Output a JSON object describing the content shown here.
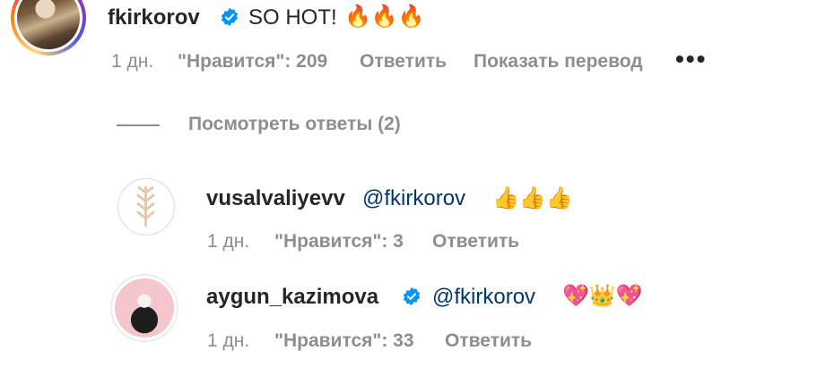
{
  "colors": {
    "text": "#262626",
    "muted": "#8e8e8e",
    "link": "#00376b",
    "verified": "#0095f6"
  },
  "main_comment": {
    "username": "fkirkorov",
    "verified": true,
    "text": "SO HOT!",
    "emoji": "🔥🔥🔥",
    "time": "1 дн.",
    "likes": "\"Нравится\": 209",
    "reply_label": "Ответить",
    "translate_label": "Показать перевод",
    "more_icon": "more-options-icon"
  },
  "view_replies": {
    "label": "Посмотреть ответы (2)"
  },
  "replies": [
    {
      "username": "vusalvaliyevv",
      "verified": false,
      "mention": "@fkirkorov",
      "emoji": "👍👍👍",
      "time": "1 дн.",
      "likes": "\"Нравится\": 3",
      "reply_label": "Ответить"
    },
    {
      "username": "aygun_kazimova",
      "verified": true,
      "mention": "@fkirkorov",
      "emoji": "💖👑💖",
      "time": "1 дн.",
      "likes": "\"Нравится\": 33",
      "reply_label": "Ответить"
    }
  ]
}
